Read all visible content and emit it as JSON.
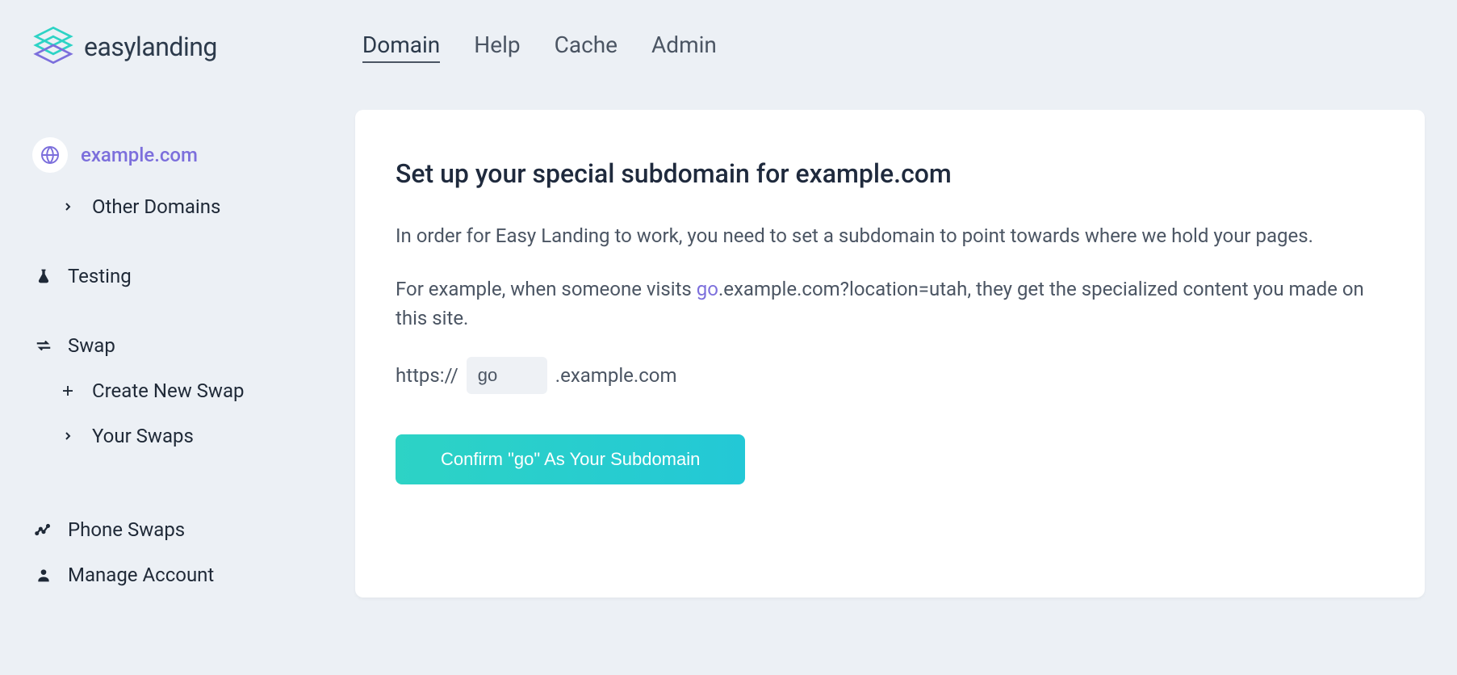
{
  "brand": {
    "name": "easylanding"
  },
  "topnav": {
    "items": [
      {
        "label": "Domain",
        "active": true
      },
      {
        "label": "Help",
        "active": false
      },
      {
        "label": "Cache",
        "active": false
      },
      {
        "label": "Admin",
        "active": false
      }
    ]
  },
  "sidebar": {
    "domain_active": "example.com",
    "other_domains": "Other Domains",
    "testing": "Testing",
    "swap": "Swap",
    "create_new_swap": "Create New Swap",
    "your_swaps": "Your Swaps",
    "phone_swaps": "Phone Swaps",
    "manage_account": "Manage Account"
  },
  "main": {
    "title": "Set up your special subdomain for example.com",
    "p1": "In order for Easy Landing to work, you need to set a subdomain to point towards where we hold your pages.",
    "p2_pre": "For example, when someone visits ",
    "p2_hl": "go",
    "p2_post": ".example.com?location=utah, they get the specialized content you made on this site.",
    "proto": "https://",
    "subdomain_value": "go",
    "suffix": ".example.com",
    "confirm_label": "Confirm \"go\" As Your Subdomain"
  }
}
